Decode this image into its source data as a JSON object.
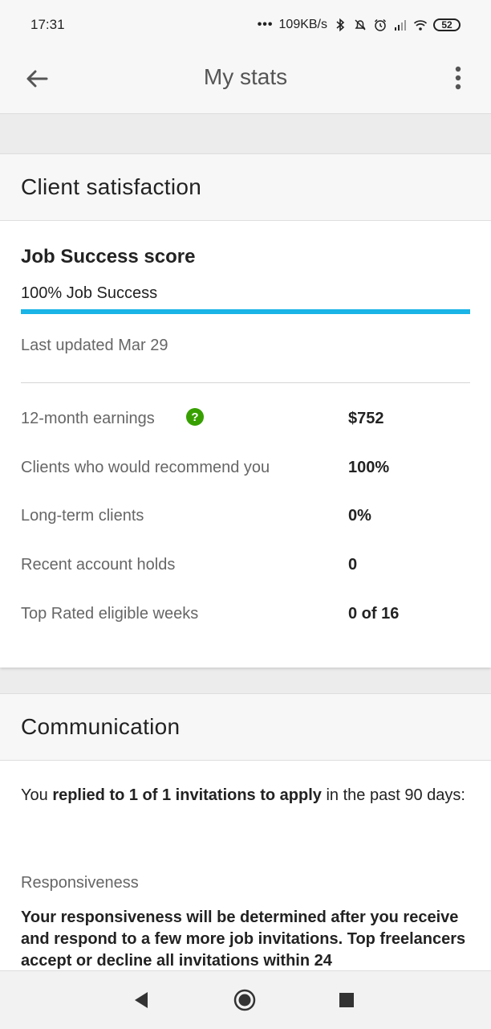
{
  "status_bar": {
    "time": "17:31",
    "network_speed": "109KB/s",
    "battery": "52",
    "icons": [
      "bluetooth-icon",
      "mute-icon",
      "alarm-icon",
      "signal-icon",
      "wifi-icon",
      "battery-icon"
    ]
  },
  "app_bar": {
    "title": "My stats",
    "back_icon": "arrow-left-icon",
    "more_icon": "more-vertical-icon"
  },
  "client_satisfaction": {
    "header": "Client satisfaction",
    "job_success_title": "Job Success score",
    "job_success_label": "100% Job Success",
    "job_success_percent": 100,
    "last_updated": "Last updated Mar 29",
    "stats": [
      {
        "label": "12-month earnings",
        "value": "$752",
        "help": "?"
      },
      {
        "label": "Clients who would recommend you",
        "value": "100%"
      },
      {
        "label": "Long-term clients",
        "value": "0%"
      },
      {
        "label": "Recent account holds",
        "value": "0"
      },
      {
        "label": "Top Rated eligible weeks",
        "value": "0 of 16"
      }
    ]
  },
  "communication": {
    "header": "Communication",
    "reply_prefix": "You ",
    "reply_bold": "replied to 1 of 1 invitations to apply",
    "reply_suffix": " in the past 90 days:",
    "responsiveness_label": "Responsiveness",
    "responsiveness_text": "Your responsiveness will be determined after you receive and respond to a few more job invitations. Top freelancers accept or decline all invitations within 24"
  },
  "colors": {
    "accent": "#1ab4e6",
    "help_green": "#37a000"
  }
}
